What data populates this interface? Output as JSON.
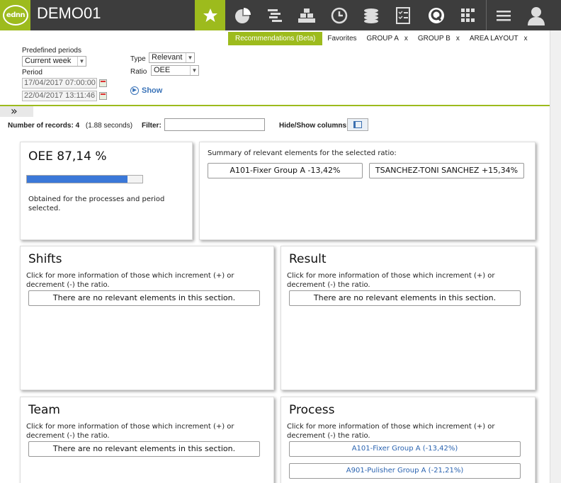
{
  "app": {
    "logo_text": "ednn",
    "title": "DEMO01"
  },
  "nav": {
    "icons": [
      "star-icon",
      "pie-chart-icon",
      "gantt-icon",
      "stacked-boxes-icon",
      "clock-icon",
      "coins-icon",
      "checklist-icon",
      "q-logo-icon",
      "grid-icon",
      "menu-icon",
      "user-icon"
    ]
  },
  "tabs": [
    {
      "label": "Recommendations (Beta)",
      "closable": false
    },
    {
      "label": "Favorites",
      "closable": false
    },
    {
      "label": "GROUP A",
      "closable": true
    },
    {
      "label": "GROUP B",
      "closable": true
    },
    {
      "label": "AREA LAYOUT",
      "closable": true
    }
  ],
  "tab_close": "x",
  "controls": {
    "predefined_label": "Predefined periods",
    "predefined_value": "Current week",
    "period_label": "Period",
    "period_start": "17/04/2017 07:00:00",
    "period_end": "22/04/2017 13:11:46",
    "type_label": "Type",
    "type_value": "Relevant",
    "ratio_label": "Ratio",
    "ratio_value": "OEE",
    "show_label": "Show"
  },
  "toolbar": {
    "records_label": "Number of records:",
    "records_value": "4",
    "records_time": "(1.88 seconds)",
    "filter_label": "Filter:",
    "filter_value": "",
    "hideshow_label": "Hide/Show columns:"
  },
  "oee": {
    "title": "OEE 87,14 %",
    "progress": 0.8714,
    "desc": "Obtained for the processes and period selected."
  },
  "summary": {
    "heading": "Summary of relevant elements for the selected ratio:",
    "items": [
      "A101-Fixer Group A -13,42%",
      "TSANCHEZ-TONI SANCHEZ +15,34%"
    ]
  },
  "section_desc": "Click for more information of those which increment (+) or decrement (-) the ratio.",
  "empty_text": "There are no relevant elements in this section.",
  "sections": {
    "shifts": "Shifts",
    "result": "Result",
    "team": "Team",
    "process": "Process"
  },
  "process_items": [
    "A101-Fixer Group A (-13,42%)",
    "A901-Pulisher Group A (-21,21%)"
  ],
  "colors": {
    "accent": "#9dbb1d",
    "header": "#3d3d3d",
    "link": "#2a63b0",
    "progress": "#3b78d8"
  }
}
